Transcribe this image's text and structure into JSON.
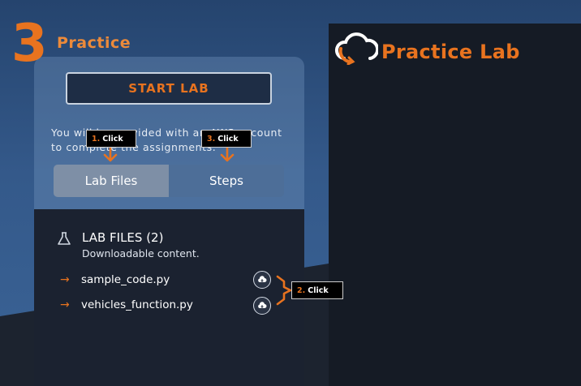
{
  "step": {
    "number": "3",
    "title": "Practice"
  },
  "start_button": {
    "label": "START LAB"
  },
  "info_text": "You will be provided with an AWS account to complete the assignments.",
  "tabs": [
    {
      "label": "Lab Files"
    },
    {
      "label": "Steps"
    }
  ],
  "lab_files": {
    "title": "LAB FILES (2)",
    "subtitle": "Downloadable content.",
    "files": [
      {
        "name": "sample_code.py"
      },
      {
        "name": "vehicles_function.py"
      }
    ]
  },
  "practice_lab": {
    "title": "Practice Lab"
  },
  "callouts": [
    {
      "num": "1.",
      "text": "Click"
    },
    {
      "num": "2.",
      "text": "Click"
    },
    {
      "num": "3.",
      "text": "Click"
    }
  ],
  "colors": {
    "accent": "#e8731f",
    "panel": "#1b2230",
    "background": "#34598a"
  },
  "icons": [
    "flask-icon",
    "arrow-right-icon",
    "cloud-download-icon",
    "cloud-refresh-icon",
    "arrow-down-icon",
    "bracket-arrow-icon"
  ]
}
